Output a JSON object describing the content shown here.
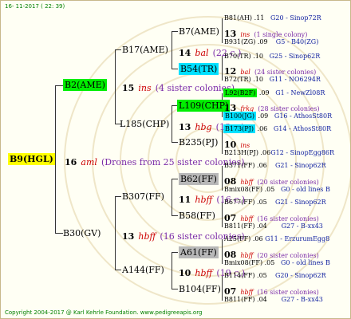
{
  "header": "16- 11-2017 ( 22: 39)",
  "footer": "Copyright 2004-2017 @ Karl Kehrle Foundation.   www.pedigreeapis.org",
  "root": {
    "name": "B9(HGL)",
    "gen": "16",
    "breeder": "aml",
    "note": "(Drones from 25 sister colonies)"
  },
  "b2": {
    "name": "B2(AME)",
    "gen": "15",
    "breeder": "ins",
    "note": "(4 sister colonies)"
  },
  "b30": {
    "name": "B30(GV)",
    "gen": "13",
    "breeder": "hbff",
    "note": "(16 sister colonies)"
  },
  "b17": {
    "name": "B17(AME)"
  },
  "l185": {
    "name": "L185(CHP)"
  },
  "b307": {
    "name": "B307(FF)"
  },
  "a144": {
    "name": "A144(FF)"
  },
  "b7": {
    "name": "B7(AME)",
    "gen": "14",
    "breeder": "bal",
    "note": "(22 c.)"
  },
  "b54": {
    "name": "B54(TR)"
  },
  "l109": {
    "name": "L109(CHP)",
    "gen": "12",
    "breeder": "frkg",
    "note": "(28 sister colonies)"
  },
  "b235": {
    "name": "B235(PJ)"
  },
  "b62": {
    "name": "B62(FF)",
    "gen": "11",
    "breeder": "hbff",
    "note": "(16 c.)"
  },
  "b58": {
    "name": "B58(FF)"
  },
  "a61": {
    "name": "A61(FF)",
    "gen": "10",
    "breeder": "hbff",
    "note": "(19 c.)"
  },
  "b104": {
    "name": "B104(FF)"
  },
  "mid": [
    {
      "gen": "13",
      "breeder": "hbg",
      "note": "(18 c.)"
    }
  ],
  "leaves": [
    {
      "name": "B81(AH)",
      "val": ".11",
      "group": "G20 - Sinop72R"
    },
    {
      "gen": "13",
      "breeder": "ins",
      "note": "(1 single colony)"
    },
    {
      "name": "B931(ZG)",
      "val": ".09",
      "group": "G5 - B40(ZG)"
    },
    {
      "name": "B70(TR)",
      "val": ".10",
      "group": "G25 - Sinop62R"
    },
    {
      "gen": "12",
      "breeder": "bal",
      "note": "(24 sister colonies)"
    },
    {
      "name": "B72(TR)",
      "val": ".10",
      "group": "G11 - NO6294R"
    },
    {
      "name": "L92(B2F)",
      "val": ".09",
      "group": "G1 - NewZl08R"
    },
    {
      "name": "B100(JG)",
      "val": ".09",
      "group": "G16 - AthosSt80R"
    },
    {
      "name": "B173(PJ)",
      "val": ".06",
      "group": "G14 - AthosSt80R"
    },
    {
      "gen": "10",
      "breeder": "ins",
      "note": ""
    },
    {
      "name": "B213H(PJ)",
      "val": ".06",
      "group": "G12 - SinopEgg86R"
    },
    {
      "name": "B371(FF)",
      "val": ".06",
      "group": "G21 - Sinop62R"
    },
    {
      "gen": "08",
      "breeder": "hbff",
      "note": "(20 sister colonies)"
    },
    {
      "name": "Bmix08(FF)",
      "val": ".05",
      "group": "G0 - old lines B"
    },
    {
      "name": "B677(FF)",
      "val": ".05",
      "group": "G21 - Sinop62R"
    },
    {
      "gen": "07",
      "breeder": "hbff",
      "note": "(16 sister colonies)"
    },
    {
      "name": "B811(FF)",
      "val": ".04",
      "group": "G27 - B-xx43"
    },
    {
      "name": "A25(FF)",
      "val": ".06",
      "group": "G11 - ErzurumEgg8"
    },
    {
      "gen": "08",
      "breeder": "hbff",
      "note": "(20 sister colonies)"
    },
    {
      "name": "Bmix08(FF)",
      "val": ".05",
      "group": "G0 - old lines B"
    },
    {
      "name": "B114(FF)",
      "val": ".05",
      "group": "G20 - Sinop62R"
    },
    {
      "gen": "07",
      "breeder": "hbff",
      "note": "(16 sister colonies)"
    },
    {
      "name": "B811(FF)",
      "val": ".04",
      "group": "G27 - B-xx43"
    }
  ]
}
